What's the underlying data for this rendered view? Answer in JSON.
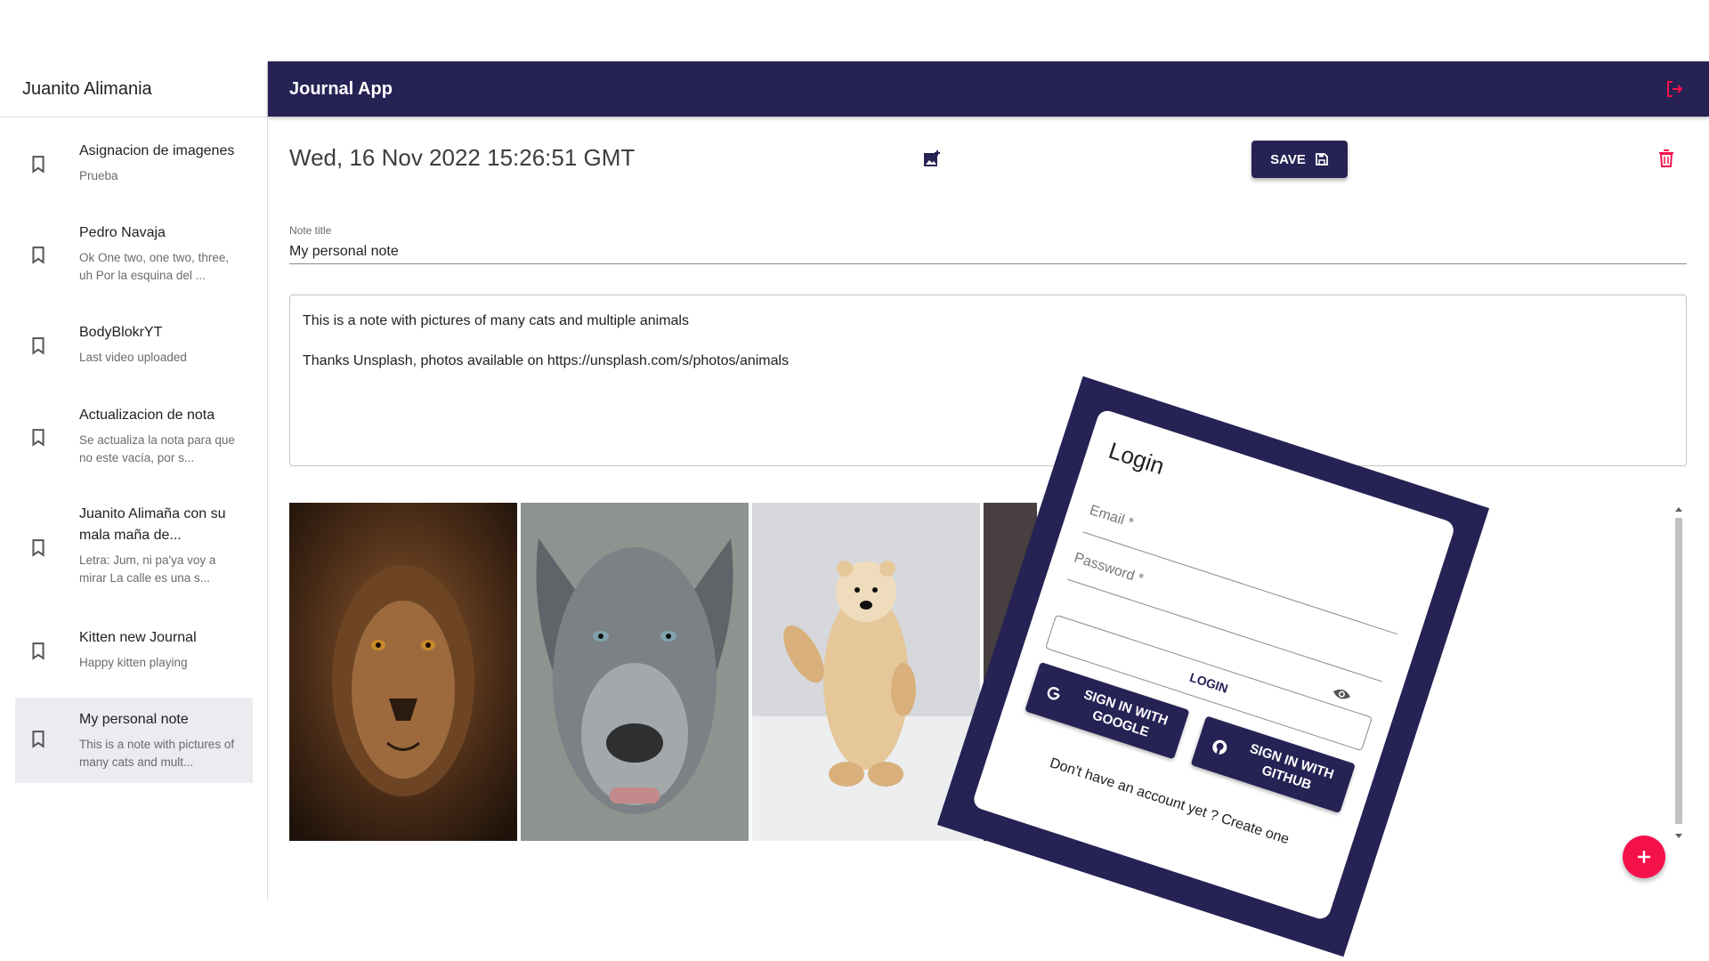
{
  "sidebar": {
    "user_name": "Juanito Alimania",
    "entries": [
      {
        "title": "Asignacion de imagenes",
        "body": "Prueba"
      },
      {
        "title": "Pedro Navaja",
        "body": "Ok One two, one two, three, uh Por la esquina del ..."
      },
      {
        "title": "BodyBlokrYT",
        "body": "Last video uploaded"
      },
      {
        "title": "Actualizacion de nota",
        "body": "Se actualiza la nota para que no este vacía, por s..."
      },
      {
        "title": "Juanito Alimaña con su mala maña de...",
        "body": "Letra: Jum, ni pa'ya voy a mirar La calle es una s..."
      },
      {
        "title": "Kitten new Journal",
        "body": "Happy kitten playing"
      },
      {
        "title": "My personal note",
        "body": "This is a note with pictures of many cats and mult..."
      }
    ]
  },
  "appbar": {
    "title": "Journal App"
  },
  "note": {
    "date": "Wed, 16 Nov 2022 15:26:51 GMT",
    "save_label": "SAVE",
    "title_label": "Note title",
    "title_value": "My personal note",
    "body_line1": "This is a note with pictures of many cats and multiple animals",
    "body_line2": "Thanks Unsplash, photos available on https://unsplash.com/s/photos/animals"
  },
  "gallery": [
    "lion",
    "pitbull-dog",
    "polar-bear",
    "animal"
  ],
  "login": {
    "title": "Login",
    "email_label": "Email *",
    "password_label": "Password *",
    "login_label": "LOGIN",
    "google_label": "SIGN IN WITH GOOGLE",
    "github_label": "SIGN IN WITH GITHUB",
    "create_account": "Don't have an account yet ? Create one"
  },
  "colors": {
    "primary": "#262254",
    "accent": "#f5114a"
  }
}
